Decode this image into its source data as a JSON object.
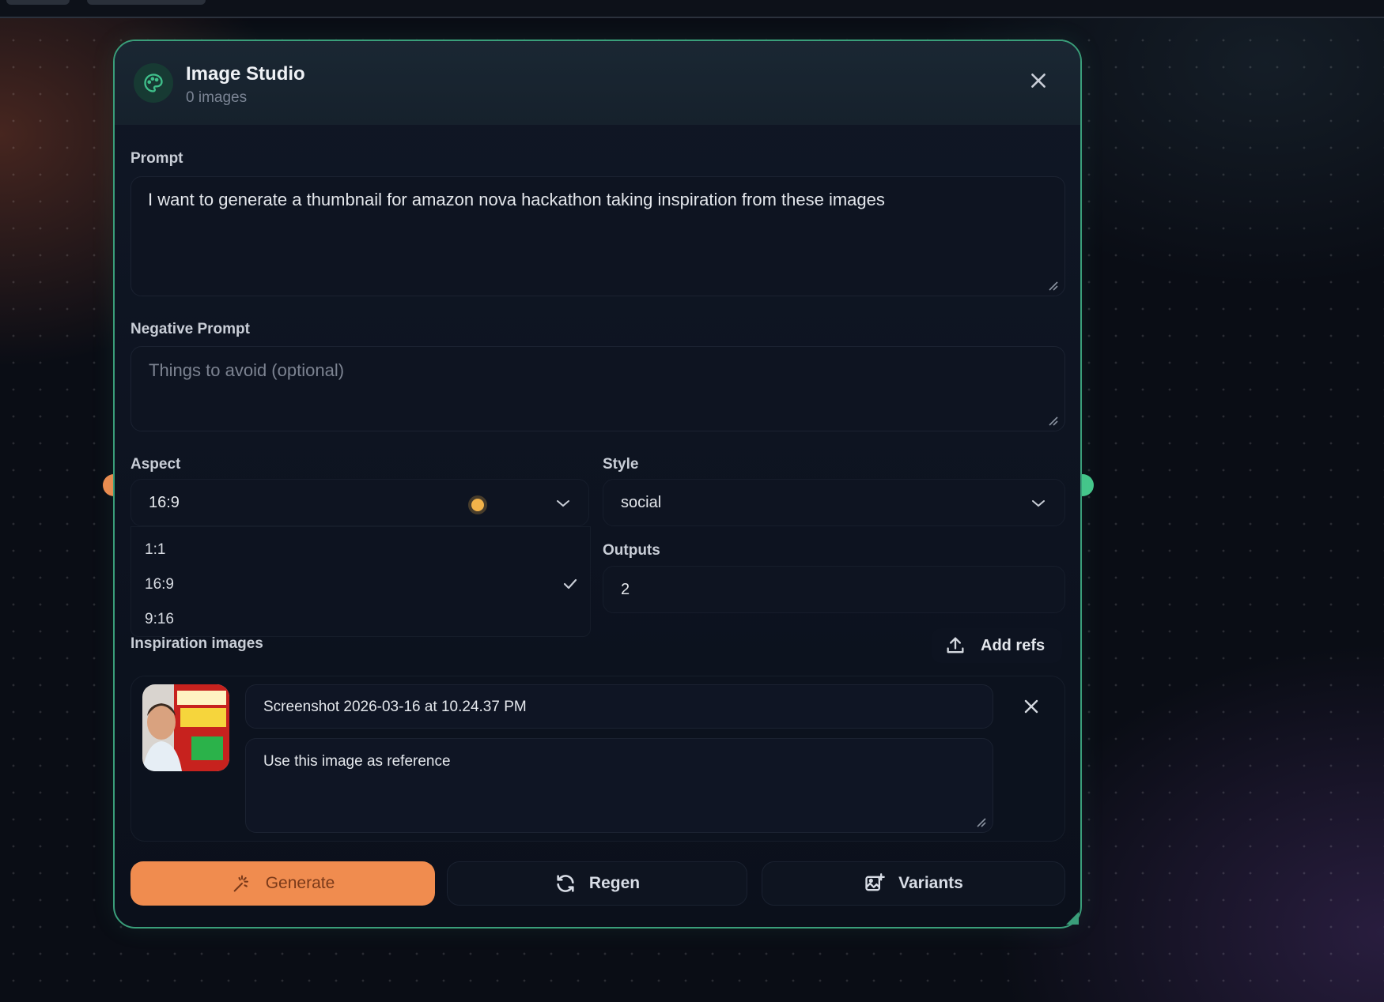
{
  "colors": {
    "accent": "#3a9e7a",
    "primary_button": "#f08c4f",
    "input_handle": "#f08c4f",
    "output_handle": "#46c88c",
    "background": "#0a0d15"
  },
  "node": {
    "title": "Image Studio",
    "subtitle": "0 images",
    "logo_icon": "palette-icon",
    "close_icon": "close-icon"
  },
  "prompt": {
    "label": "Prompt",
    "value": "I want to generate a thumbnail for amazon nova hackathon taking inspiration from these images"
  },
  "negative_prompt": {
    "label": "Negative Prompt",
    "placeholder": "Things to avoid (optional)",
    "value": ""
  },
  "aspect": {
    "label": "Aspect",
    "selected": "16:9",
    "options": [
      "1:1",
      "16:9",
      "9:16"
    ],
    "dropdown_open": true
  },
  "style": {
    "label": "Style",
    "selected": "social"
  },
  "outputs": {
    "label": "Outputs",
    "value": "2"
  },
  "inspiration": {
    "label": "Inspiration images",
    "add_refs_label": "Add refs",
    "add_refs_icon": "upload-icon",
    "items": [
      {
        "filename": "Screenshot 2026-03-16 at 10.24.37 PM",
        "note": "Use this image as reference"
      }
    ]
  },
  "actions": {
    "generate_label": "Generate",
    "generate_icon": "sparkles-icon",
    "regen_label": "Regen",
    "regen_icon": "refresh-icon",
    "variants_label": "Variants",
    "variants_icon": "image-plus-icon"
  }
}
